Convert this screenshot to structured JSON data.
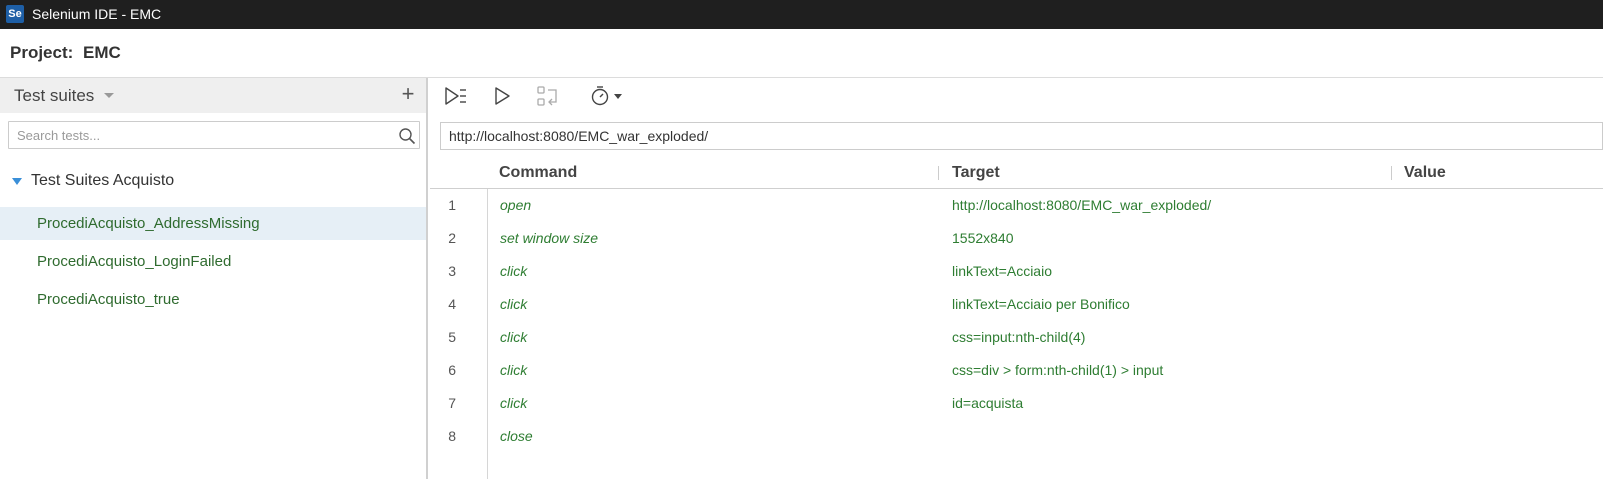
{
  "window": {
    "title": "Selenium IDE - EMC",
    "icon_text": "Se"
  },
  "project": {
    "label": "Project:",
    "name": "EMC"
  },
  "sidebar": {
    "header_title": "Test suites",
    "add_button": "+",
    "search_placeholder": "Search tests...",
    "suite": {
      "name": "Test Suites Acquisto",
      "tests": [
        {
          "label": "ProcediAcquisto_AddressMissing",
          "selected": true
        },
        {
          "label": "ProcediAcquisto_LoginFailed",
          "selected": false
        },
        {
          "label": "ProcediAcquisto_true",
          "selected": false
        }
      ]
    }
  },
  "toolbar": {
    "icons": [
      "run-all-tests-icon",
      "run-current-test-icon",
      "step-over-icon",
      "test-speed-icon"
    ]
  },
  "url": {
    "value": "http://localhost:8080/EMC_war_exploded/"
  },
  "table": {
    "headers": {
      "command": "Command",
      "target": "Target",
      "value": "Value"
    },
    "rows": [
      {
        "num": "1",
        "command": "open",
        "target": "http://localhost:8080/EMC_war_exploded/",
        "value": ""
      },
      {
        "num": "2",
        "command": "set window size",
        "target": "1552x840",
        "value": ""
      },
      {
        "num": "3",
        "command": "click",
        "target": "linkText=Acciaio",
        "value": ""
      },
      {
        "num": "4",
        "command": "click",
        "target": "linkText=Acciaio per Bonifico",
        "value": ""
      },
      {
        "num": "5",
        "command": "click",
        "target": "css=input:nth-child(4)",
        "value": ""
      },
      {
        "num": "6",
        "command": "click",
        "target": "css=div > form:nth-child(1) > input",
        "value": ""
      },
      {
        "num": "7",
        "command": "click",
        "target": "id=acquista",
        "value": ""
      },
      {
        "num": "8",
        "command": "close",
        "target": "",
        "value": ""
      }
    ]
  },
  "colors": {
    "titlebar": "#1f1f1f",
    "command_text": "#2e7d32",
    "test_text": "#2f6b2f",
    "selected_row": "#e6eff6",
    "suite_caret": "#3a8fd8"
  }
}
